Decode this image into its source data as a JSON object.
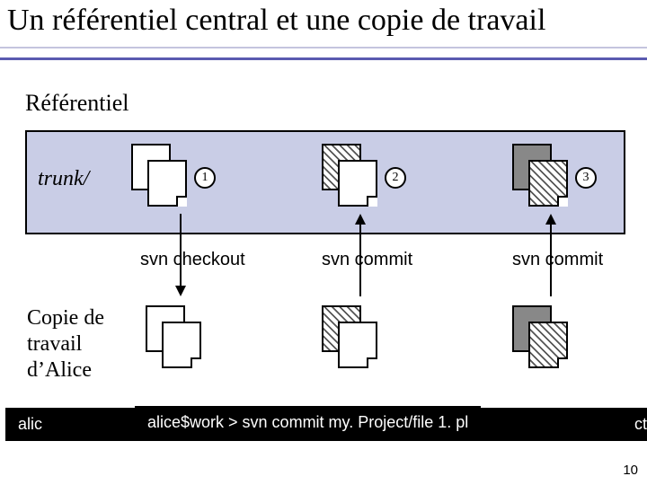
{
  "title": "Un référentiel central et une copie de travail",
  "repo_label": "Référentiel",
  "trunk_label": "trunk/",
  "wc_label_l1": "Copie de",
  "wc_label_l2": "travail",
  "wc_label_l3": "d’Alice",
  "rev1": "1",
  "rev2": "2",
  "rev3": "3",
  "cmd_checkout": "svn checkout",
  "cmd_commit": "svn commit",
  "term_back_left": "alic",
  "term_back_right": "ct",
  "term_front": "alice$work > svn commit my. Project/file 1. pl",
  "page_num": "10"
}
